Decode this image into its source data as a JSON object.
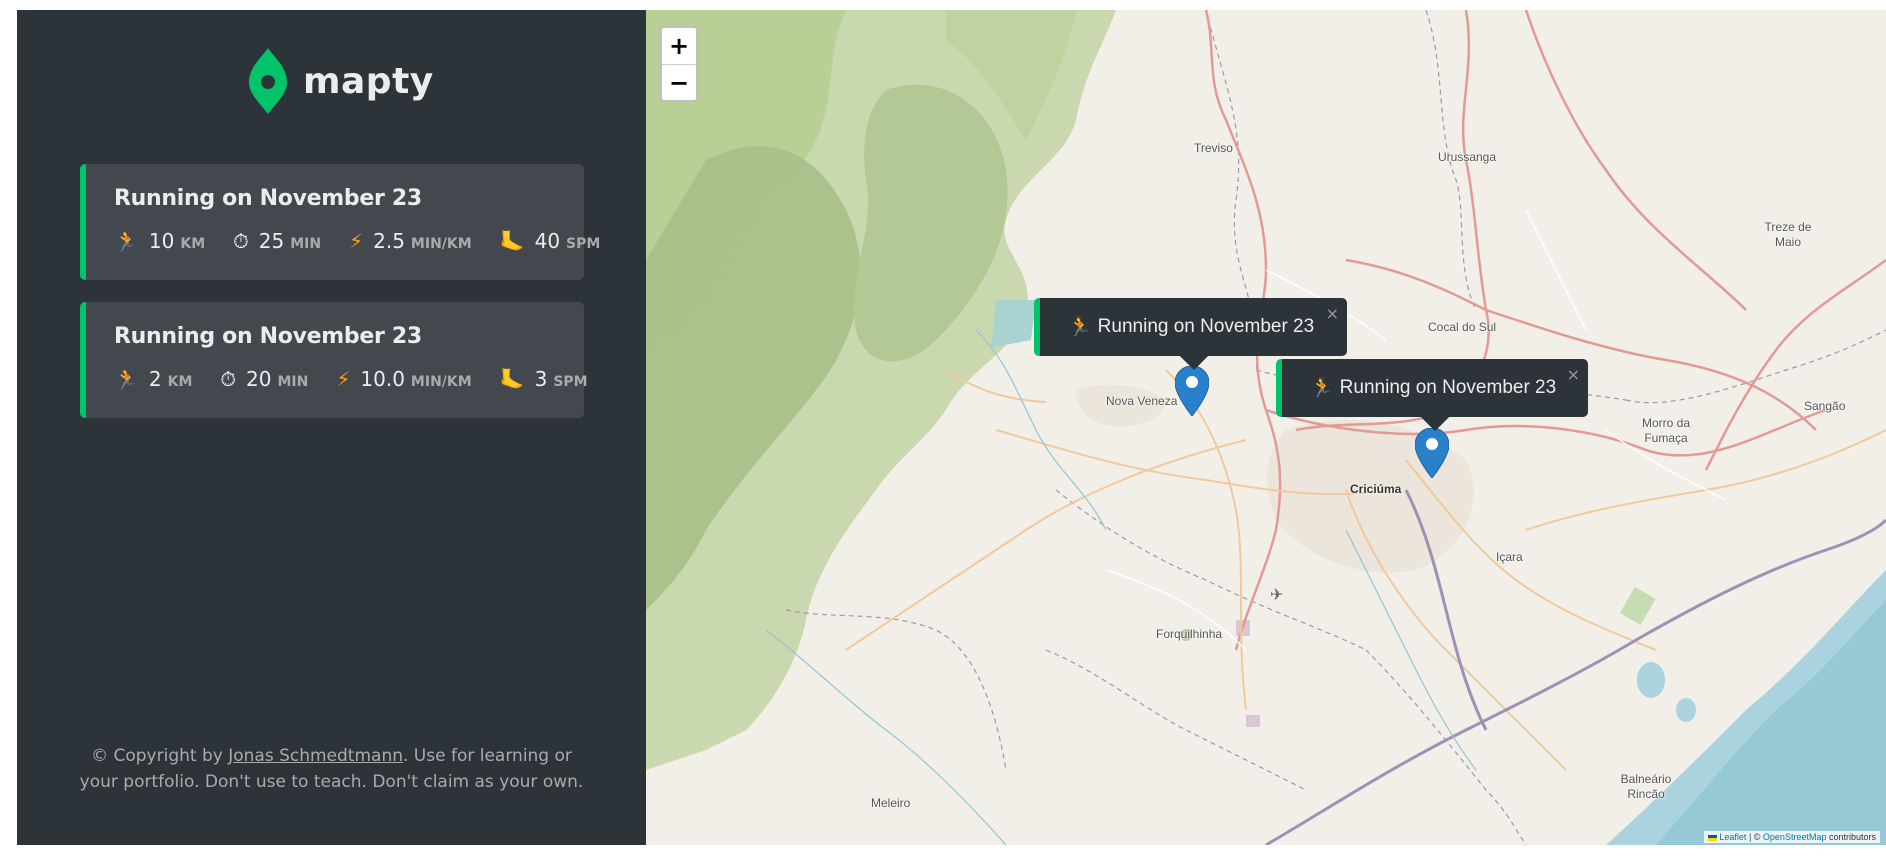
{
  "brand": {
    "name": "mapty",
    "accent": "#00c46a"
  },
  "workouts": [
    {
      "title": "Running on November 23",
      "type": "running",
      "distance": {
        "value": "10",
        "unit": "km",
        "icon": "runner-icon"
      },
      "duration": {
        "value": "25",
        "unit": "min",
        "icon": "stopwatch-icon"
      },
      "pace": {
        "value": "2.5",
        "unit": "min/km",
        "icon": "lightning-icon"
      },
      "cadence": {
        "value": "40",
        "unit": "spm",
        "icon": "foot-icon"
      }
    },
    {
      "title": "Running on November 23",
      "type": "running",
      "distance": {
        "value": "2",
        "unit": "km",
        "icon": "runner-icon"
      },
      "duration": {
        "value": "20",
        "unit": "min",
        "icon": "stopwatch-icon"
      },
      "pace": {
        "value": "10.0",
        "unit": "min/km",
        "icon": "lightning-icon"
      },
      "cadence": {
        "value": "3",
        "unit": "spm",
        "icon": "foot-icon"
      }
    }
  ],
  "footer": {
    "prefix": "© Copyright by ",
    "author": "Jonas Schmedtmann",
    "suffix": ". Use for learning or your portfolio. Don't use to teach. Don't claim as your own."
  },
  "map": {
    "zoom_in": "+",
    "zoom_out": "−",
    "popups": [
      {
        "label": "Running on November 23",
        "close": "×"
      },
      {
        "label": "Running on November 23",
        "close": "×"
      }
    ],
    "place_labels": [
      "Treviso",
      "Urussanga",
      "Treze de Maio",
      "Cocal do Sul",
      "Nova Veneza",
      "Criciúma",
      "Morro da Fumaça",
      "Sangão",
      "Içara",
      "Forquilhinha",
      "Meleiro",
      "Balneário Rincão"
    ],
    "attribution": {
      "leaflet": "Leaflet",
      "sep": " | © ",
      "osm": "OpenStreetMap",
      "suffix": " contributors"
    }
  }
}
